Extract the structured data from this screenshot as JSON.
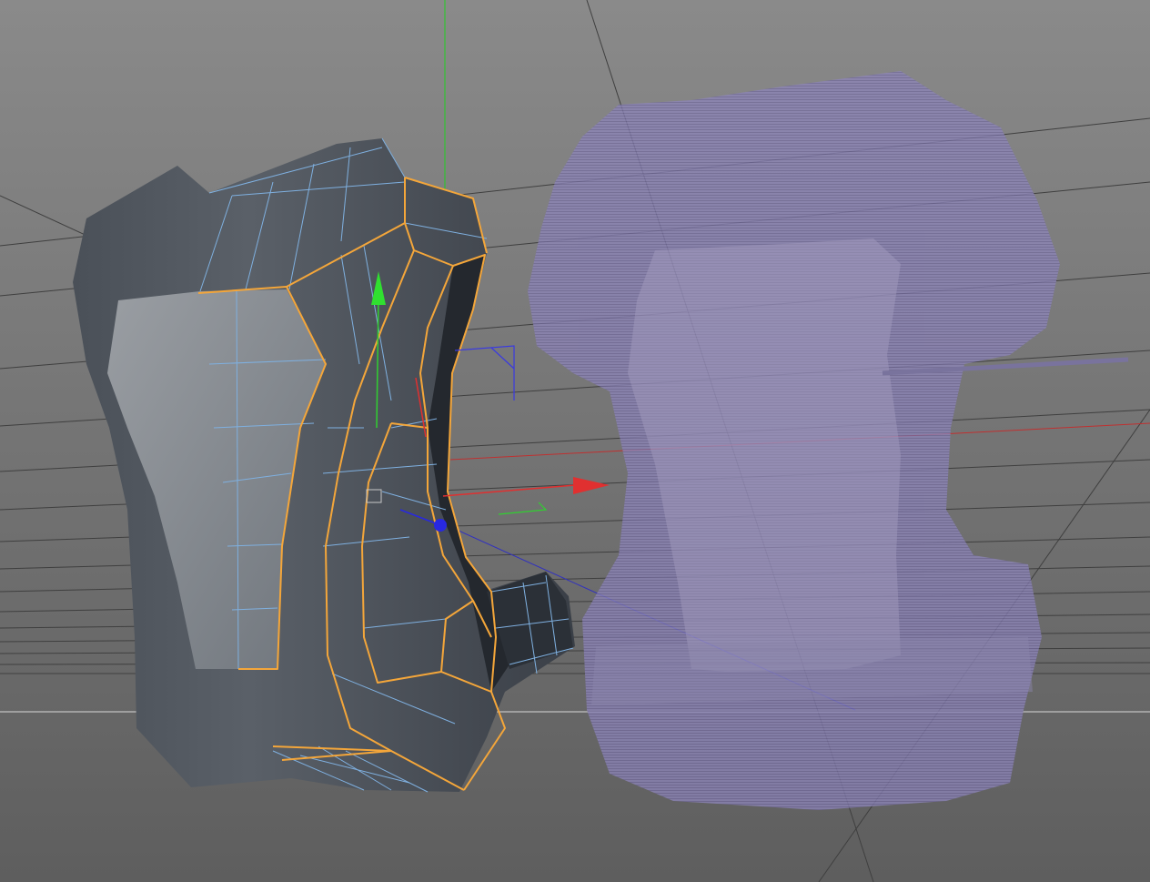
{
  "viewport": {
    "background_top": "#8a8a8a",
    "background_bottom": "#5e5e5e",
    "grid_color": "#3f3f3f",
    "horizon_color": "#d8d8d8"
  },
  "colors": {
    "selection_edge": "#f4a63a",
    "wire_edge": "#7fb0e0",
    "mesh_dark": "#3e434b",
    "mesh_light": "#8e9398",
    "ghost_fill": "#8a80b8",
    "axis_x": "#e02020",
    "axis_y": "#20d020",
    "axis_z": "#2020e0"
  },
  "objects": [
    {
      "name": "edited-mesh",
      "state": "selected"
    },
    {
      "name": "reference-mesh",
      "state": "x-ray"
    }
  ],
  "gizmo": {
    "mode": "move",
    "handles": [
      "x-axis-handle",
      "y-axis-handle",
      "z-axis-handle",
      "view-plane-handle",
      "rotate-handle"
    ]
  }
}
